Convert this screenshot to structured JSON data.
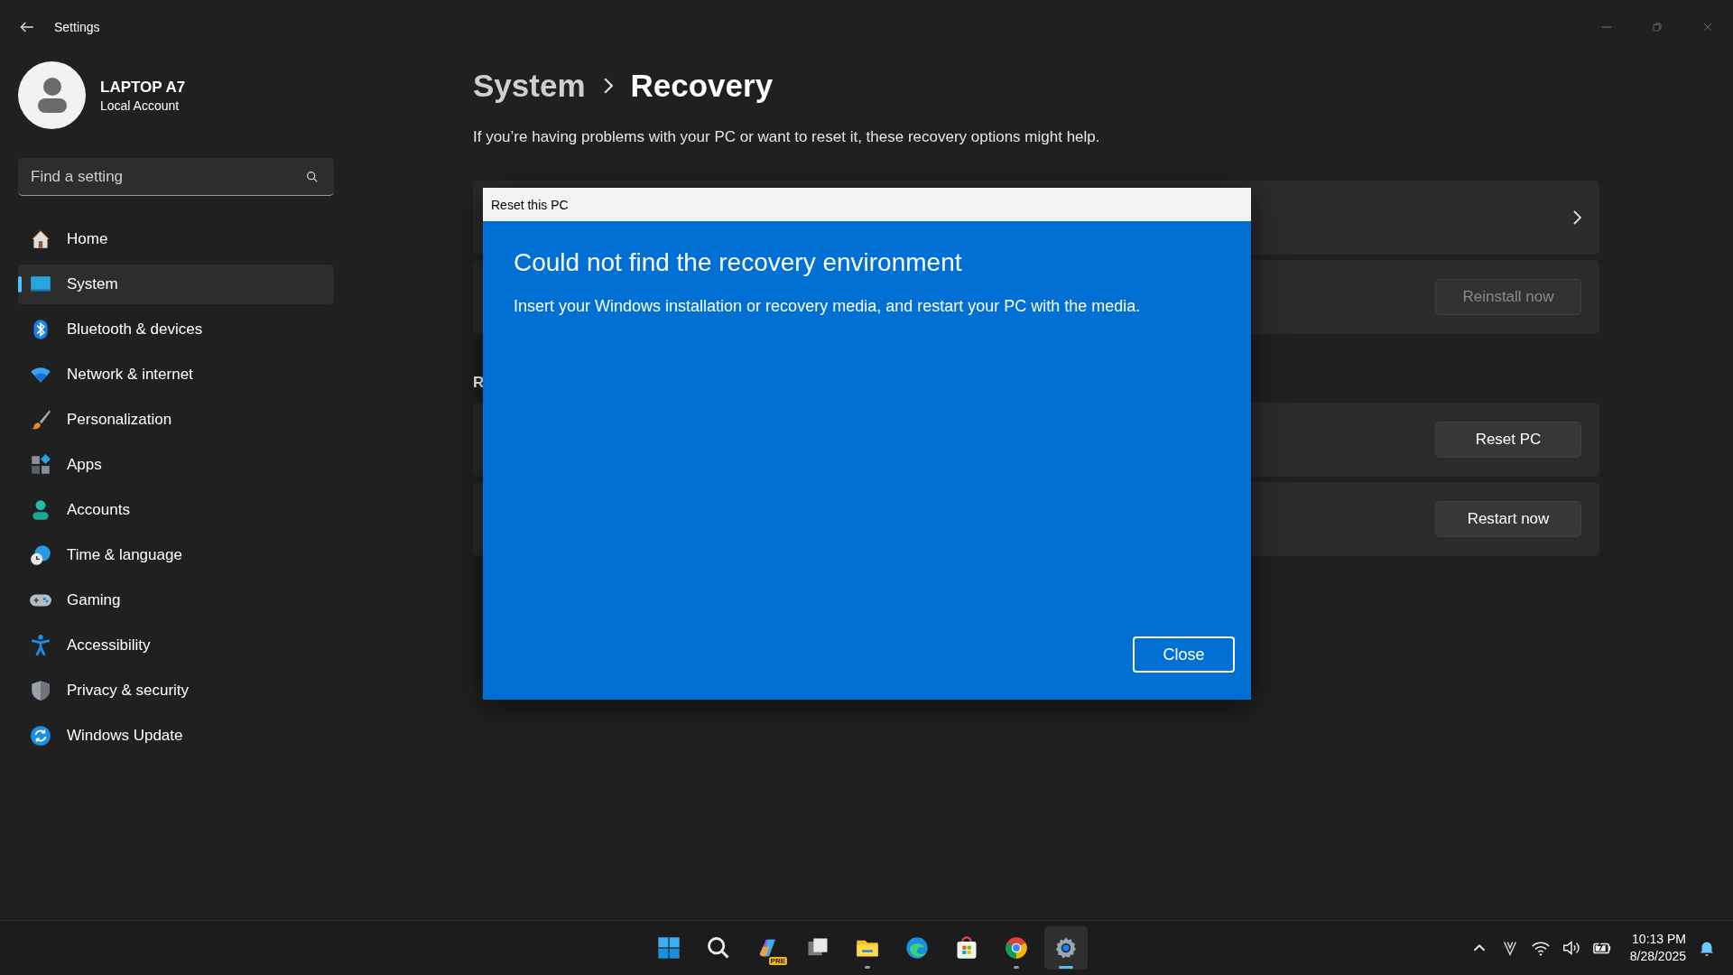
{
  "window": {
    "title": "Settings"
  },
  "account": {
    "name": "LAPTOP A7",
    "type": "Local Account"
  },
  "search": {
    "placeholder": "Find a setting"
  },
  "nav": [
    {
      "label": "Home",
      "selected": false
    },
    {
      "label": "System",
      "selected": true
    },
    {
      "label": "Bluetooth & devices",
      "selected": false
    },
    {
      "label": "Network & internet",
      "selected": false
    },
    {
      "label": "Personalization",
      "selected": false
    },
    {
      "label": "Apps",
      "selected": false
    },
    {
      "label": "Accounts",
      "selected": false
    },
    {
      "label": "Time & language",
      "selected": false
    },
    {
      "label": "Gaming",
      "selected": false
    },
    {
      "label": "Accessibility",
      "selected": false
    },
    {
      "label": "Privacy & security",
      "selected": false
    },
    {
      "label": "Windows Update",
      "selected": false
    }
  ],
  "breadcrumb": {
    "parent": "System",
    "current": "Recovery"
  },
  "description": "If you’re having problems with your PC or want to reset it, these recovery options might help.",
  "cards_top": [
    {
      "kind": "chevron"
    },
    {
      "kind": "button",
      "button": "Reinstall now",
      "disabled": true
    }
  ],
  "section_heading": "R",
  "cards_bottom": [
    {
      "kind": "button",
      "button": "Reset PC",
      "disabled": false
    },
    {
      "kind": "button",
      "button": "Restart now",
      "disabled": false
    }
  ],
  "dialog": {
    "title": "Reset this PC",
    "heading": "Could not find the recovery environment",
    "body": "Insert your Windows installation or recovery media, and restart your PC with the media.",
    "button": "Close"
  },
  "taskbar": {
    "apps": [
      {
        "running": false,
        "selected": false
      },
      {
        "running": false,
        "selected": false
      },
      {
        "running": false,
        "selected": false,
        "badge": "PRE"
      },
      {
        "running": false,
        "selected": false
      },
      {
        "running": true,
        "selected": false
      },
      {
        "running": false,
        "selected": false
      },
      {
        "running": false,
        "selected": false
      },
      {
        "running": true,
        "selected": false
      },
      {
        "running": true,
        "selected": true
      }
    ],
    "time": "10:13 PM",
    "date": "8/28/2025"
  }
}
